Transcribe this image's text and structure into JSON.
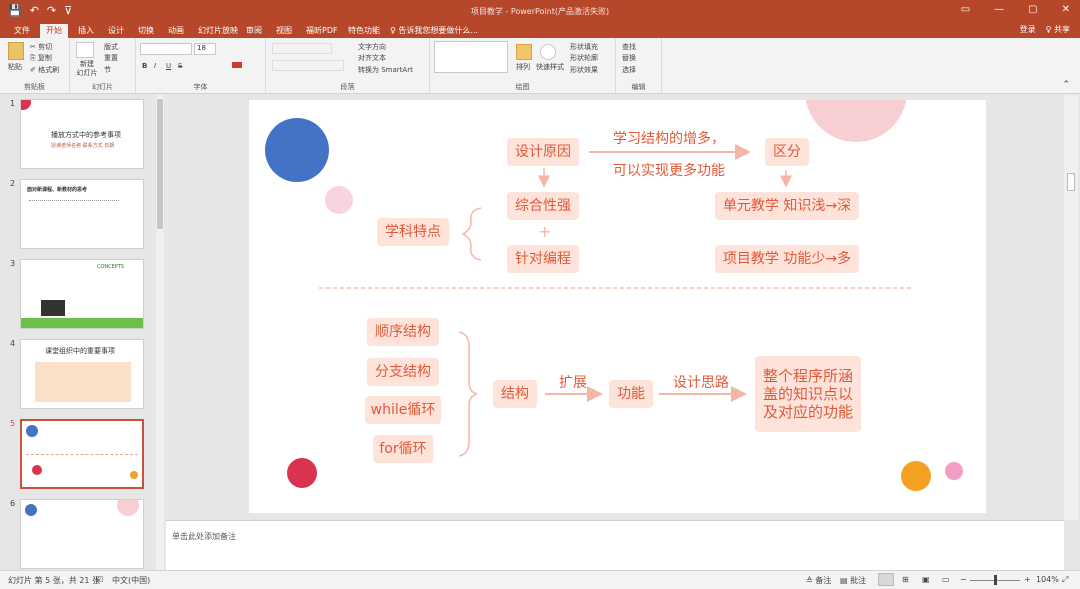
{
  "window": {
    "title": "项目教学 - PowerPoint(产品激活失败)",
    "quick_access": [
      "💾",
      "↶",
      "↷",
      "⊽"
    ],
    "controls": [
      "▭",
      "—",
      "▢",
      "✕"
    ]
  },
  "tabs": [
    "文件",
    "开始",
    "插入",
    "设计",
    "切换",
    "动画",
    "幻灯片放映",
    "审阅",
    "视图",
    "福昕PDF",
    "特色功能"
  ],
  "active_tab": "开始",
  "tell_me": "♀ 告诉我您想要做什么...",
  "account": {
    "login": "登录",
    "share": "♀ 共享"
  },
  "ribbon": {
    "groups": [
      "剪贴板",
      "幻灯片",
      "字体",
      "段落",
      "绘图",
      "编辑"
    ],
    "paste": "粘贴",
    "cut": "✂ 剪切",
    "copy": "⎘ 复制",
    "format_painter": "✐ 格式刷",
    "new_slide": "新建\n幻灯片",
    "layout": "版式",
    "reset": "重置",
    "section": "节",
    "font_size": "18",
    "bold": "B",
    "italic": "I",
    "underline": "U",
    "strike": "S",
    "text_direction": "文字方向",
    "align_text": "对齐文本",
    "smartart": "转换为 SmartArt",
    "arrange": "排列",
    "quick_styles": "快速样式",
    "shape_fill": "形状填充",
    "shape_outline": "形状轮廓",
    "shape_effects": "形状效果",
    "find": "查找",
    "replace": "替换",
    "select": "选择"
  },
  "thumbnails": [
    {
      "num": "1",
      "title": "播放方式中的参考事项",
      "subtitle": "授课老师名称 联系方式 日期"
    },
    {
      "num": "2",
      "title": "面对新课程、新教材的思考"
    },
    {
      "num": "3",
      "title": "CONCEPTS"
    },
    {
      "num": "4",
      "title": "课堂组织中的重要事项"
    },
    {
      "num": "5"
    },
    {
      "num": "6"
    }
  ],
  "slide": {
    "top": {
      "design_reason": "设计原因",
      "arrow_text_1": "学习结构的增多，",
      "arrow_text_2": "可以实现更多功能",
      "distinguish": "区分",
      "comprehensive": "综合性强",
      "plus": "+",
      "targeted": "针对编程",
      "subject_feature": "学科特点",
      "unit_teaching": "单元教学 知识浅→深",
      "project_teaching": "项目教学 功能少→多"
    },
    "bottom": {
      "items": [
        "顺序结构",
        "分支结构",
        "while循环",
        "for循环"
      ],
      "structure": "结构",
      "extend": "扩展",
      "function": "功能",
      "design_idea": "设计思路",
      "result": "整个程序所涵盖的知识点以及对应的功能"
    }
  },
  "notes_placeholder": "单击此处添加备注",
  "status": {
    "slide_info": "幻灯片 第 5 张，共 21 张",
    "language": "中文(中国)",
    "notes": "≜ 备注",
    "comments": "▤ 批注",
    "zoom": "104%"
  },
  "colors": {
    "accent": "#b7472a",
    "box_fill": "#fde3da",
    "box_text": "#e05a3a"
  }
}
